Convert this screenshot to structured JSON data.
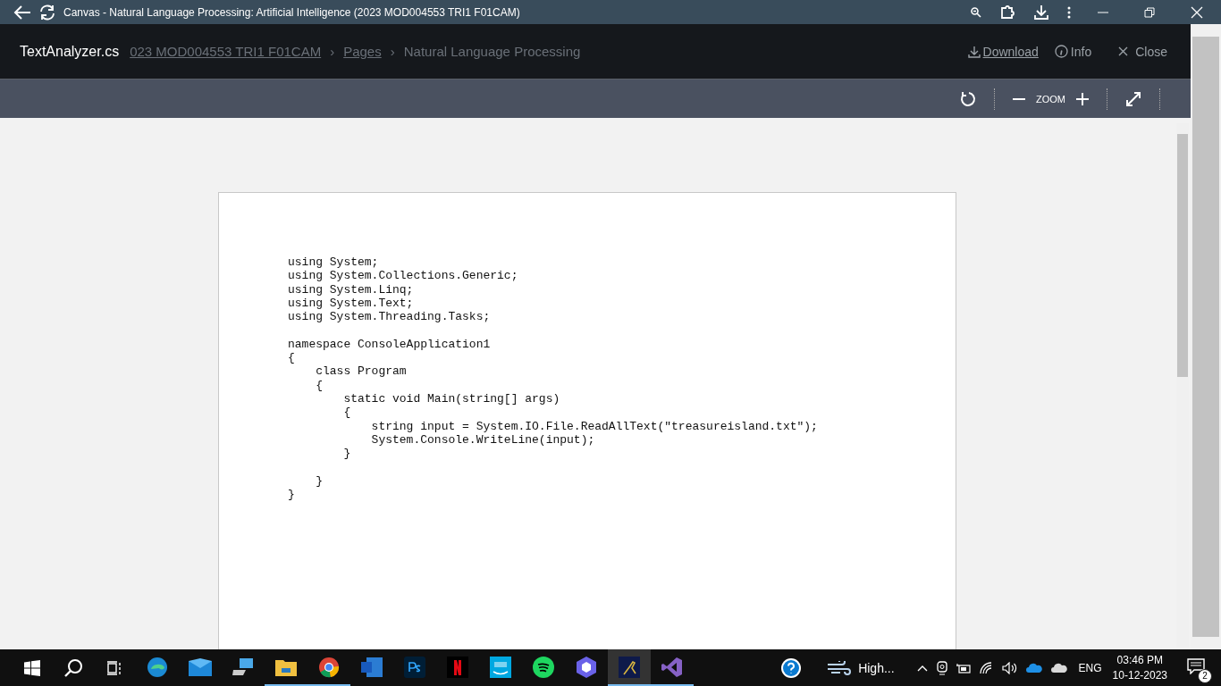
{
  "browser": {
    "title": "Canvas - Natural Language Processing: Artificial Intelligence (2023 MOD004553 TRI1 F01CAM)"
  },
  "breadcrumb": {
    "items": [
      "023 MOD004553 TRI1 F01CAM",
      "Pages",
      "Natural Language Processing"
    ],
    "separator": "›"
  },
  "viewer": {
    "file_name": "TextAnalyzer.cs",
    "actions": [
      {
        "kind": "download",
        "label": "Download"
      },
      {
        "kind": "info",
        "label": "Info"
      },
      {
        "kind": "close",
        "label": "Close"
      }
    ],
    "zoom_label": "ZOOM"
  },
  "document": {
    "code": "using System;\nusing System.Collections.Generic;\nusing System.Linq;\nusing System.Text;\nusing System.Threading.Tasks;\n\nnamespace ConsoleApplication1\n{\n    class Program\n    {\n        static void Main(string[] args)\n        {\n            string input = System.IO.File.ReadAllText(\"treasureisland.txt\");\n            System.Console.WriteLine(input);\n        }\n\n    }\n}"
  },
  "taskbar": {
    "apps": [
      {
        "kind": "edge",
        "running": false,
        "selected": false
      },
      {
        "kind": "mail",
        "running": false,
        "selected": false
      },
      {
        "kind": "pc",
        "running": false,
        "selected": false
      },
      {
        "kind": "folder",
        "running": true,
        "selected": false
      },
      {
        "kind": "chrome",
        "running": true,
        "selected": false
      },
      {
        "kind": "word",
        "running": false,
        "selected": false
      },
      {
        "kind": "photoshop",
        "running": false,
        "selected": false
      },
      {
        "kind": "netflix",
        "running": false,
        "selected": false
      },
      {
        "kind": "video",
        "running": false,
        "selected": false
      },
      {
        "kind": "spotify",
        "running": false,
        "selected": false
      },
      {
        "kind": "cube",
        "running": false,
        "selected": false
      },
      {
        "kind": "bird",
        "running": true,
        "selected": true
      },
      {
        "kind": "studio",
        "running": true,
        "selected": false
      }
    ],
    "weather": "High...",
    "language": "ENG",
    "time": "03:46 PM",
    "date": "10-12-2023",
    "notifications": "2"
  }
}
